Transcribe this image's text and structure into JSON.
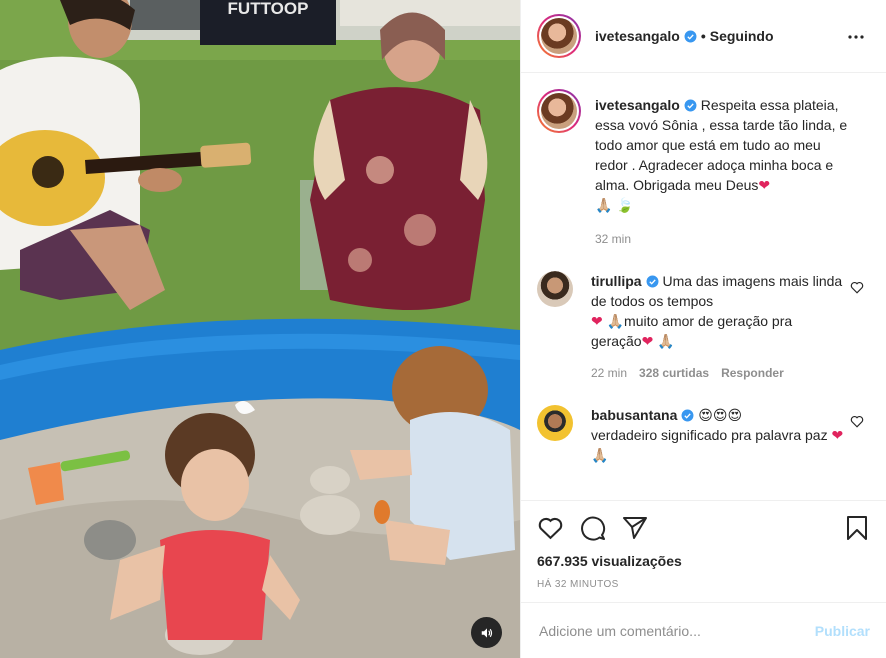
{
  "media": {
    "banner_text": "FUTTOOP",
    "mute_icon": "speaker-icon"
  },
  "header": {
    "username": "ivetesangalo",
    "separator": "•",
    "follow_status": "Seguindo",
    "more_icon": "more-options-icon"
  },
  "caption": {
    "username": "ivetesangalo",
    "text": "Respeita essa plateia, essa vovó Sônia , essa tarde tão linda, e todo amor que está em tudo ao meu redor . Agradecer adoça minha boca e alma. Obrigada meu Deus",
    "emoji_line": "🙏🏼 🍃",
    "time": "32 min"
  },
  "comments": [
    {
      "username": "tirullipa",
      "text_part1": "Uma das imagens mais linda de todos os tempos",
      "text_part2": "🙏🏼muito amor de geração pra geração",
      "text_part3": "🙏🏼",
      "time": "22 min",
      "likes": "328 curtidas",
      "reply": "Responder"
    },
    {
      "username": "babusantana",
      "emojis": "😍😍😍",
      "text": "verdadeiro significado pra palavra paz",
      "text_end": "🙏🏼"
    }
  ],
  "actions": {
    "views": "667.935 visualizações",
    "time_ago": "HÁ 32 MINUTOS"
  },
  "add_comment": {
    "placeholder": "Adicione um comentário...",
    "publish": "Publicar"
  },
  "colors": {
    "verified": "#3897f0",
    "heart": "#ed4956",
    "publish_disabled": "#b2dffc",
    "pool_blue": "#1f7fd1"
  }
}
